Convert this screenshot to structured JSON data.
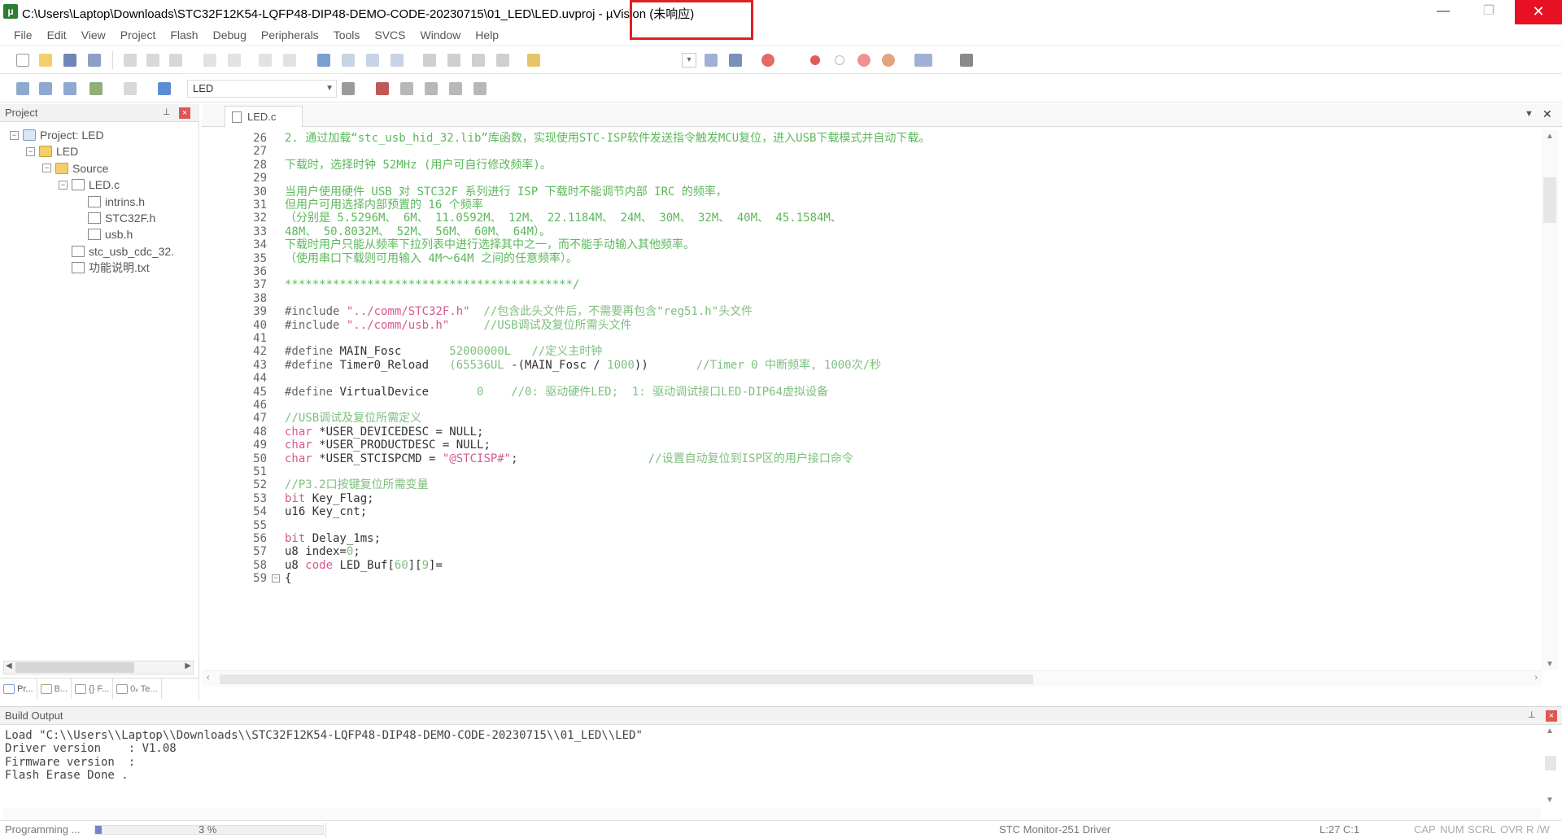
{
  "window": {
    "title": "C:\\Users\\Laptop\\Downloads\\STC32F12K54-LQFP48-DIP48-DEMO-CODE-20230715\\01_LED\\LED.uvproj - µVision  (未响应)",
    "minimize": "—",
    "maximize": "❐",
    "close": "✕"
  },
  "menu": [
    "File",
    "Edit",
    "View",
    "Project",
    "Flash",
    "Debug",
    "Peripherals",
    "Tools",
    "SVCS",
    "Window",
    "Help"
  ],
  "toolbar": {
    "target_name": "LED"
  },
  "project_panel": {
    "title": "Project",
    "tree": [
      {
        "label": "Project: LED",
        "kind": "project",
        "toggle": "−"
      },
      {
        "label": "LED",
        "kind": "folder",
        "toggle": "−"
      },
      {
        "label": "Source",
        "kind": "folder",
        "toggle": "−"
      },
      {
        "label": "LED.c",
        "kind": "file",
        "toggle": "−"
      },
      {
        "label": "intrins.h",
        "kind": "file",
        "toggle": ""
      },
      {
        "label": "STC32F.h",
        "kind": "file",
        "toggle": ""
      },
      {
        "label": "usb.h",
        "kind": "file",
        "toggle": ""
      },
      {
        "label": "stc_usb_cdc_32.",
        "kind": "file",
        "toggle": ""
      },
      {
        "label": "功能说明.txt",
        "kind": "file",
        "toggle": ""
      }
    ],
    "tabs": [
      "Pr...",
      "B...",
      "{} F...",
      "0ₓ Te..."
    ]
  },
  "editor": {
    "tab_label": "LED.c",
    "lines": [
      {
        "n": "26",
        "parts": [
          {
            "t": "2. 通过加载“stc_usb_hid_32.lib”库函数，实现使用STC-ISP软件发送指令触发MCU复位，进入USB下载模式并自动下载。",
            "c": "green"
          }
        ]
      },
      {
        "n": "27",
        "parts": []
      },
      {
        "n": "28",
        "parts": [
          {
            "t": "下载时，选择时钟 52MHz (用户可自行修改频率)。",
            "c": "green"
          }
        ]
      },
      {
        "n": "29",
        "parts": []
      },
      {
        "n": "30",
        "parts": [
          {
            "t": "当用户使用硬件 USB 对 STC32F 系列进行 ISP 下载时不能调节内部 IRC 的频率，",
            "c": "green"
          }
        ]
      },
      {
        "n": "31",
        "parts": [
          {
            "t": "但用户可用选择内部预置的 16 个频率",
            "c": "green"
          }
        ]
      },
      {
        "n": "32",
        "parts": [
          {
            "t": "（分别是 5.5296M、 6M、 11.0592M、 12M、 22.1184M、 24M、 30M、 32M、 40M、 45.1584M、",
            "c": "green"
          }
        ]
      },
      {
        "n": "33",
        "parts": [
          {
            "t": "48M、 50.8032M、 52M、 56M、 60M、 64M）。",
            "c": "green"
          }
        ]
      },
      {
        "n": "34",
        "parts": [
          {
            "t": "下载时用户只能从频率下拉列表中进行选择其中之一，而不能手动输入其他频率。",
            "c": "green"
          }
        ]
      },
      {
        "n": "35",
        "parts": [
          {
            "t": "（使用串口下载则可用输入 4M～64M 之间的任意频率）。",
            "c": "green"
          }
        ]
      },
      {
        "n": "36",
        "parts": []
      },
      {
        "n": "37",
        "parts": [
          {
            "t": "******************************************/",
            "c": "green"
          }
        ]
      },
      {
        "n": "38",
        "parts": []
      },
      {
        "n": "39",
        "parts": [
          {
            "t": "#include ",
            "c": "gray"
          },
          {
            "t": "\"../comm/STC32F.h\"",
            "c": "pink"
          },
          {
            "t": "  //包含此头文件后，不需要再包含\"reg51.h\"头文件",
            "c": "comment"
          }
        ]
      },
      {
        "n": "40",
        "parts": [
          {
            "t": "#include ",
            "c": "gray"
          },
          {
            "t": "\"../comm/usb.h\"",
            "c": "pink"
          },
          {
            "t": "     //USB调试及复位所需头文件",
            "c": "comment"
          }
        ]
      },
      {
        "n": "41",
        "parts": []
      },
      {
        "n": "42",
        "parts": [
          {
            "t": "#define ",
            "c": "gray"
          },
          {
            "t": "MAIN_Fosc       ",
            "c": "dark"
          },
          {
            "t": "52000000L",
            "c": "comment"
          },
          {
            "t": "   //定义主时钟",
            "c": "comment"
          }
        ]
      },
      {
        "n": "43",
        "parts": [
          {
            "t": "#define ",
            "c": "gray"
          },
          {
            "t": "Timer0_Reload   ",
            "c": "dark"
          },
          {
            "t": "(65536UL ",
            "c": "comment"
          },
          {
            "t": "-(MAIN_Fosc / ",
            "c": "dark"
          },
          {
            "t": "1000",
            "c": "comment"
          },
          {
            "t": "))",
            "c": "dark"
          },
          {
            "t": "       //Timer 0 中断频率, 1000次/秒",
            "c": "comment"
          }
        ]
      },
      {
        "n": "44",
        "parts": []
      },
      {
        "n": "45",
        "parts": [
          {
            "t": "#define ",
            "c": "gray"
          },
          {
            "t": "VirtualDevice       ",
            "c": "dark"
          },
          {
            "t": "0",
            "c": "comment"
          },
          {
            "t": "    //0: 驱动硬件LED;  1: 驱动调试接口LED-DIP64虚拟设备",
            "c": "comment"
          }
        ]
      },
      {
        "n": "46",
        "parts": []
      },
      {
        "n": "47",
        "parts": [
          {
            "t": "//USB调试及复位所需定义",
            "c": "comment"
          }
        ]
      },
      {
        "n": "48",
        "parts": [
          {
            "t": "char ",
            "c": "pink"
          },
          {
            "t": "*USER_DEVICEDESC = NULL;",
            "c": "dark"
          }
        ]
      },
      {
        "n": "49",
        "parts": [
          {
            "t": "char ",
            "c": "pink"
          },
          {
            "t": "*USER_PRODUCTDESC = NULL;",
            "c": "dark"
          }
        ]
      },
      {
        "n": "50",
        "parts": [
          {
            "t": "char ",
            "c": "pink"
          },
          {
            "t": "*USER_STCISPCMD = ",
            "c": "dark"
          },
          {
            "t": "\"@STCISP#\"",
            "c": "pink"
          },
          {
            "t": ";",
            "c": "dark"
          },
          {
            "t": "                   //设置自动复位到ISP区的用户接口命令",
            "c": "comment"
          }
        ]
      },
      {
        "n": "51",
        "parts": []
      },
      {
        "n": "52",
        "parts": [
          {
            "t": "//P3.2口按键复位所需变量",
            "c": "comment"
          }
        ]
      },
      {
        "n": "53",
        "parts": [
          {
            "t": "bit ",
            "c": "pink"
          },
          {
            "t": "Key_Flag;",
            "c": "dark"
          }
        ]
      },
      {
        "n": "54",
        "parts": [
          {
            "t": "u16 Key_cnt;",
            "c": "dark"
          }
        ]
      },
      {
        "n": "55",
        "parts": []
      },
      {
        "n": "56",
        "parts": [
          {
            "t": "bit ",
            "c": "pink"
          },
          {
            "t": "Delay_1ms;",
            "c": "dark"
          }
        ]
      },
      {
        "n": "57",
        "parts": [
          {
            "t": "u8 index=",
            "c": "dark"
          },
          {
            "t": "0",
            "c": "comment"
          },
          {
            "t": ";",
            "c": "dark"
          }
        ]
      },
      {
        "n": "58",
        "parts": [
          {
            "t": "u8 ",
            "c": "dark"
          },
          {
            "t": "code ",
            "c": "pink"
          },
          {
            "t": "LED_Buf[",
            "c": "dark"
          },
          {
            "t": "60",
            "c": "comment"
          },
          {
            "t": "][",
            "c": "dark"
          },
          {
            "t": "9",
            "c": "comment"
          },
          {
            "t": "]=",
            "c": "dark"
          }
        ]
      },
      {
        "n": "59",
        "parts": [
          {
            "t": "{",
            "c": "dark"
          }
        ],
        "fold": "−"
      }
    ]
  },
  "build_output": {
    "title": "Build Output",
    "lines": [
      "Load \"C:\\\\Users\\\\Laptop\\\\Downloads\\\\STC32F12K54-LQFP48-DIP48-DEMO-CODE-20230715\\\\01_LED\\\\LED\"",
      "Driver version    : V1.08",
      "Firmware version  :",
      "Flash Erase Done ."
    ]
  },
  "status": {
    "programming_label": "Programming ...",
    "progress_fraction": 0.03,
    "progress_text": "3 %",
    "driver": "STC Monitor-251 Driver",
    "position": "L:27 C:1",
    "caps": "CAP",
    "num": "NUM",
    "scrl": "SCRL",
    "ovr": "OVR",
    "rw": "R /W"
  },
  "colors": {
    "title_highlight": "#e02020",
    "close_button": "#e81123",
    "comment": "#7fbf7f",
    "keyword": "#d6598f",
    "progress": "#7088c8"
  }
}
